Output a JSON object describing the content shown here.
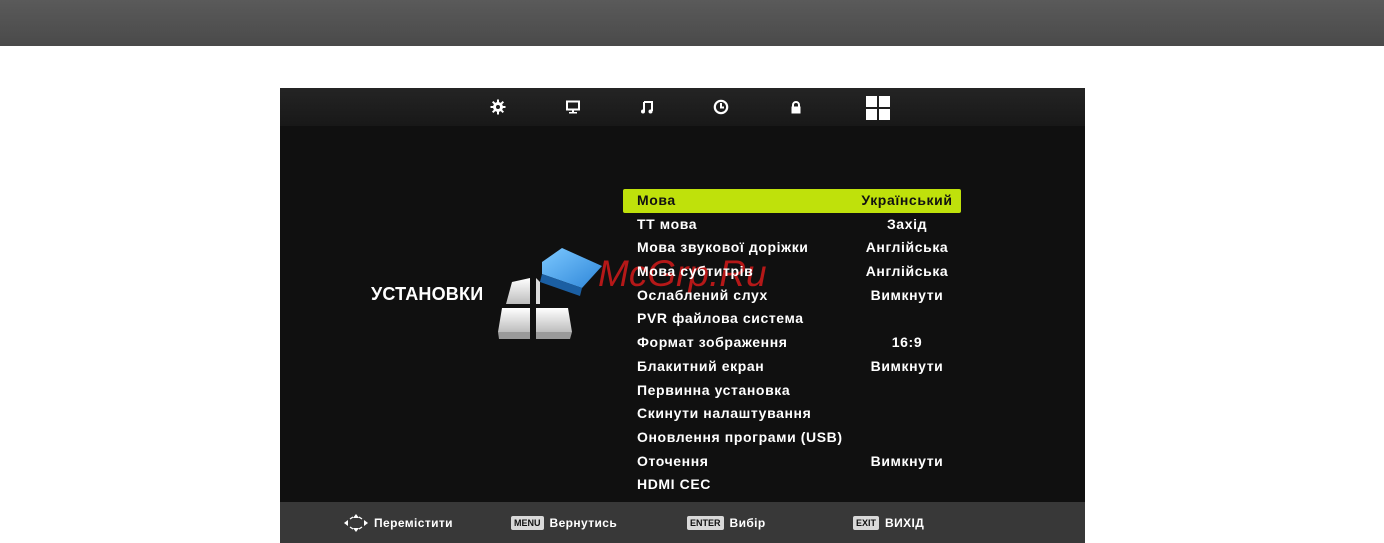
{
  "section_title": "УСТАНОВКИ",
  "watermark": "McGrp.Ru",
  "icons": [
    "gear-icon",
    "monitor-icon",
    "music-icon",
    "clock-icon",
    "lock-icon",
    "grid-icon"
  ],
  "menu": [
    {
      "label": "Мова",
      "value": "Український",
      "selected": true
    },
    {
      "label": "ТТ мова",
      "value": "Захід"
    },
    {
      "label": "Мова звукової доріжки",
      "value": "Англійська"
    },
    {
      "label": "Мова субтитрів",
      "value": "Англійська"
    },
    {
      "label": "Ослаблений слух",
      "value": "Вимкнути"
    },
    {
      "label": "PVR файлова система",
      "value": ""
    },
    {
      "label": "Формат зображення",
      "value": "16:9"
    },
    {
      "label": "Блакитний екран",
      "value": "Вимкнути"
    },
    {
      "label": "Первинна установка",
      "value": ""
    },
    {
      "label": "Скинути налаштування",
      "value": ""
    },
    {
      "label": "Оновлення програми (USB)",
      "value": ""
    },
    {
      "label": "Оточення",
      "value": "Вимкнути"
    },
    {
      "label": "HDMI CEC",
      "value": ""
    }
  ],
  "footer": {
    "move_label": "Перемістити",
    "menu_key": "MENU",
    "back_label": "Вернутись",
    "enter_key": "ENTER",
    "select_label": "Вибір",
    "exit_key": "EXIT",
    "exit_label": "ВИХІД"
  },
  "colors": {
    "accent": "#bfe10b",
    "background": "#101010",
    "logo_blue": "#3a9ee6"
  }
}
